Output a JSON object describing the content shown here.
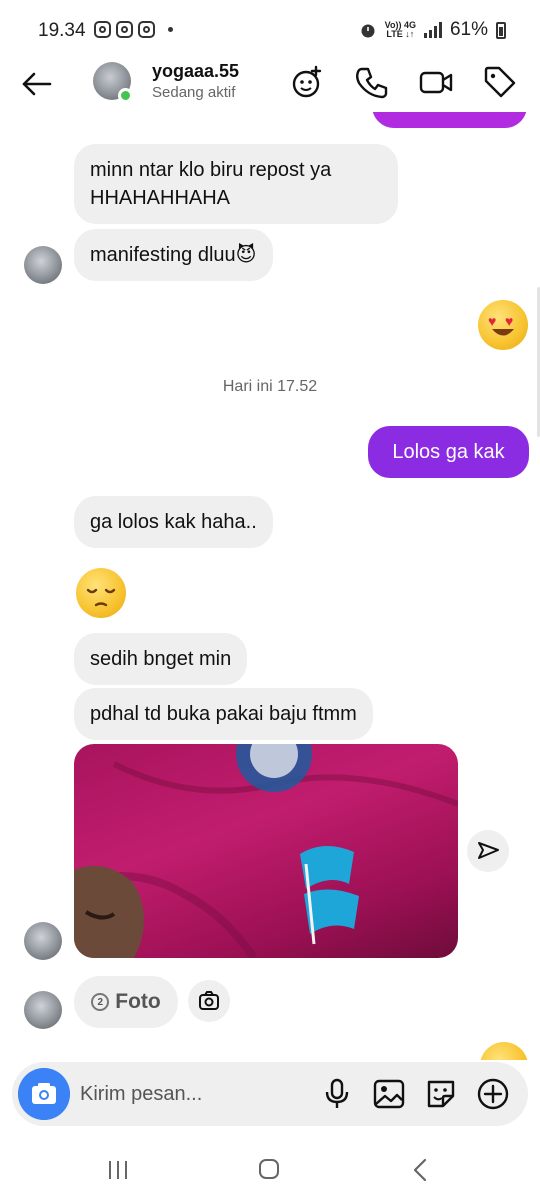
{
  "status_bar": {
    "time": "19.34",
    "battery": "61%",
    "network_top": "Vo)) 4G",
    "network_bottom": "LTE ↓↑"
  },
  "header": {
    "username": "yogaaa.55",
    "status": "Sedang aktif",
    "icons": [
      "back-arrow-icon",
      "effects-icon",
      "phone-icon",
      "video-icon",
      "tag-icon"
    ]
  },
  "messages": {
    "m1": "minn ntar klo biru repost ya HHAHAHHAHA",
    "m2": "manifesting dluu😈",
    "timestamp": "Hari ini 17.52",
    "sent": "Lolos ga kak",
    "m3": "ga lolos kak haha..",
    "m4": "sedih bnget min",
    "m5": "pdhal td buka pakai baju ftmm",
    "foto_label": "Foto",
    "foto_count": "2"
  },
  "composer": {
    "placeholder": "Kirim pesan...",
    "icons": [
      "camera-icon",
      "microphone-icon",
      "gallery-icon",
      "sticker-icon",
      "add-icon"
    ]
  },
  "colors": {
    "sent_bubble": "#8b2be2",
    "received_bubble": "#efefef",
    "online_dot": "#44c552",
    "camera_button": "#3b82f6"
  }
}
